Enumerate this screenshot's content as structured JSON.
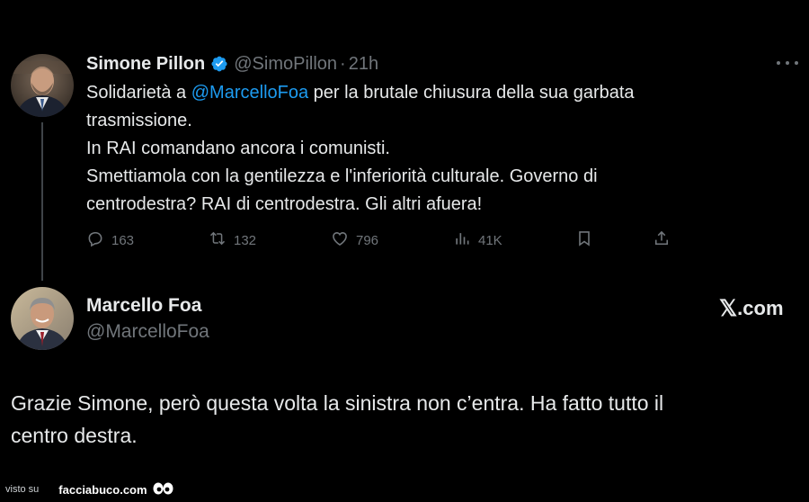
{
  "tweet": {
    "author": {
      "display_name": "Simone Pillon",
      "handle": "@SimoPillon",
      "time": "21h",
      "verified": true
    },
    "separator": "·",
    "text": {
      "line1_prefix": "Solidarietà a ",
      "line1_mention": "@MarcelloFoa",
      "line1_suffix": " per la brutale chiusura della sua garbata",
      "line2": "trasmissione.",
      "line3": "In RAI comandano ancora i comunisti.",
      "line4": "Smettiamola con la gentilezza e l'inferiorità culturale. Governo di",
      "line5": "centrodestra? RAI di centrodestra. Gli altri afuera!"
    },
    "stats": {
      "replies": "163",
      "reposts": "132",
      "likes": "796",
      "views": "41K"
    },
    "icons": {
      "more": "more-icon",
      "verified": "verified-badge-icon",
      "reply": "reply-icon",
      "repost": "repost-icon",
      "like": "like-icon",
      "views": "views-icon",
      "bookmark": "bookmark-icon",
      "share": "share-icon"
    }
  },
  "reply": {
    "author": {
      "display_name": "Marcello Foa",
      "handle": "@MarcelloFoa"
    },
    "brand": {
      "x": "𝕏",
      "domain": ".com"
    },
    "text": {
      "line1": "Grazie Simone, però questa volta la sinistra non c’entra. Ha fatto tutto il",
      "line2": "centro destra."
    }
  },
  "footer": {
    "prefix": "visto su",
    "site": "facciabuco.com"
  },
  "colors": {
    "background": "#000000",
    "text": "#e7e9ea",
    "secondary": "#71767b",
    "accent": "#1d9bf0"
  }
}
